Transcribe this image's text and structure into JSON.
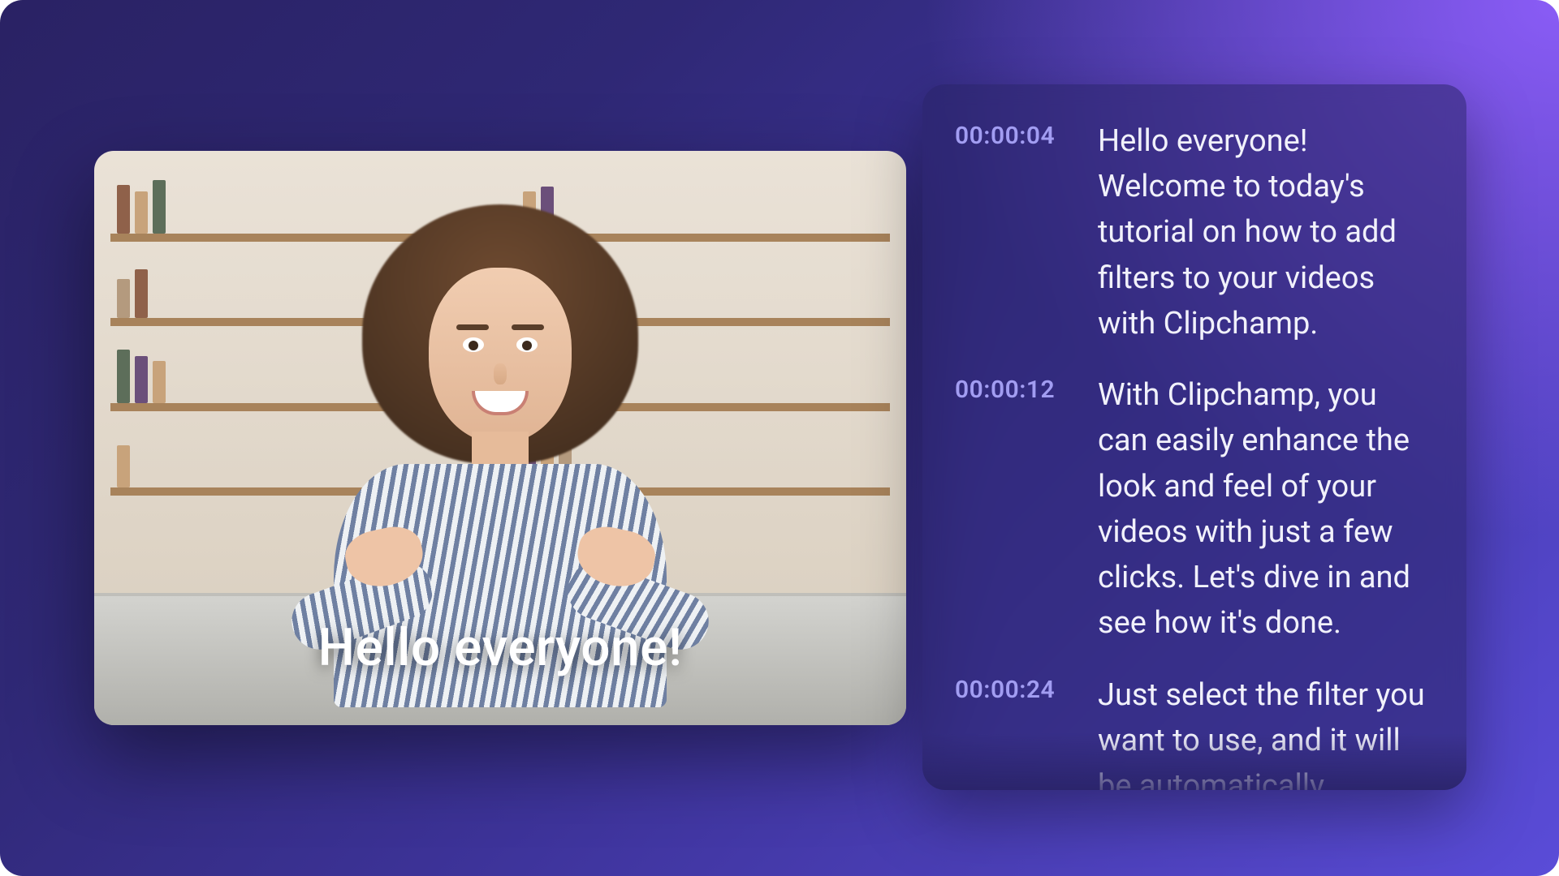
{
  "video": {
    "caption_overlay": "Hello everyone!"
  },
  "transcript": {
    "entries": [
      {
        "time": "00:00:04",
        "text": "Hello everyone! Welcome to today's tutorial on how to add filters to your videos with Clipchamp."
      },
      {
        "time": "00:00:12",
        "text": "With Clipchamp, you can easily enhance the look and feel of your videos with just a few clicks. Let's dive in and see how it's done."
      },
      {
        "time": "00:00:24",
        "text": "Just select the filter you want to use, and it will be automatically"
      }
    ]
  },
  "colors": {
    "timestamp": "#a29df2"
  }
}
